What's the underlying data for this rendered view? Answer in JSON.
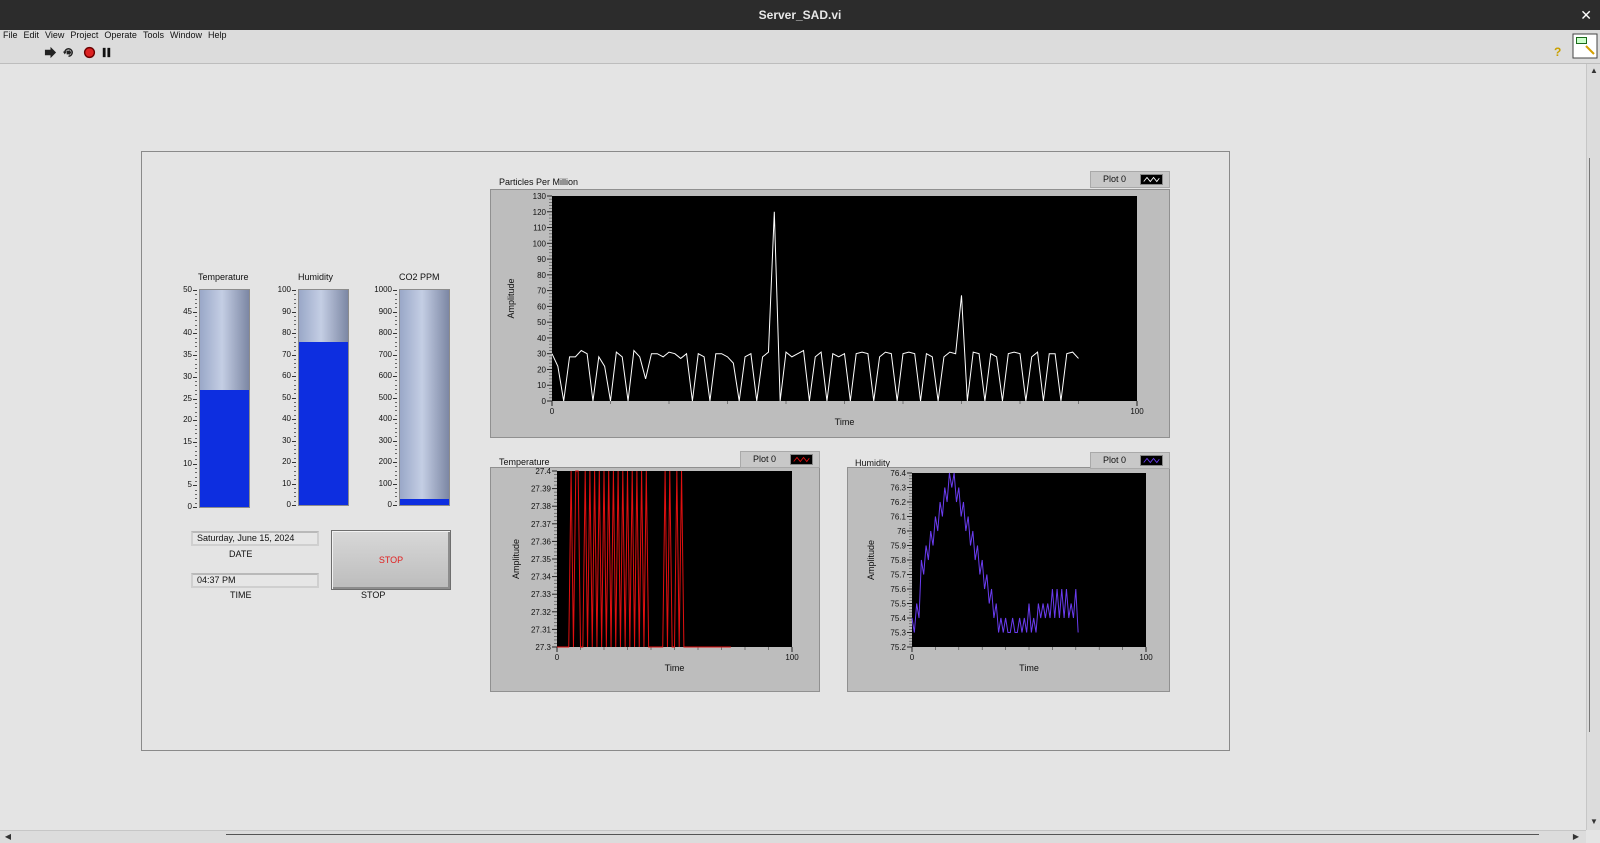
{
  "window": {
    "title": "Server_SAD.vi",
    "close_glyph": "✕"
  },
  "menu": [
    "File",
    "Edit",
    "View",
    "Project",
    "Operate",
    "Tools",
    "Window",
    "Help"
  ],
  "toolbar": {
    "icons": [
      "run-arrow-icon",
      "run-continuously-icon",
      "abort-icon",
      "pause-icon"
    ],
    "help_glyph": "?"
  },
  "tanks": [
    {
      "label": "Temperature",
      "scale": [
        "50",
        "45",
        "40",
        "35",
        "30",
        "25",
        "20",
        "15",
        "10",
        "5",
        "0"
      ],
      "max": 50,
      "value": 27,
      "fill_color": "#0d2ee0"
    },
    {
      "label": "Humidity",
      "scale": [
        "100",
        "90",
        "80",
        "70",
        "60",
        "50",
        "40",
        "30",
        "20",
        "10",
        "0"
      ],
      "max": 100,
      "value": 76,
      "fill_color": "#0d2ee0"
    },
    {
      "label": "CO2 PPM",
      "scale": [
        "1000",
        "900",
        "800",
        "700",
        "600",
        "500",
        "400",
        "300",
        "200",
        "100",
        "0"
      ],
      "max": 1000,
      "value": 30,
      "fill_color": "#0d2ee0"
    }
  ],
  "date": {
    "value": "Saturday, June 15, 2024",
    "label": "DATE"
  },
  "time": {
    "value": "04:37 PM",
    "label": "TIME"
  },
  "stop": {
    "button_text": "STOP",
    "label": "STOP"
  },
  "chart_data": [
    {
      "type": "line",
      "title": "Particles Per Million",
      "xlabel": "Time",
      "ylabel": "Amplitude",
      "xlim": [
        0,
        100
      ],
      "ylim": [
        0,
        130
      ],
      "xticks": [
        "0",
        "100"
      ],
      "yticks": [
        "130",
        "120",
        "110",
        "100",
        "90",
        "80",
        "70",
        "60",
        "50",
        "40",
        "30",
        "20",
        "10",
        "0"
      ],
      "legend": {
        "position": "top-right",
        "entry": "Plot 0"
      },
      "series": [
        {
          "color": "#ffffff",
          "values": [
            30,
            22,
            0,
            28,
            28,
            32,
            30,
            0,
            28,
            22,
            0,
            31,
            28,
            0,
            32,
            28,
            14,
            30,
            30,
            28,
            31,
            30,
            27,
            30,
            0,
            30,
            28,
            0,
            30,
            30,
            28,
            24,
            0,
            28,
            30,
            0,
            28,
            31,
            120,
            0,
            31,
            28,
            30,
            32,
            0,
            28,
            31,
            0,
            30,
            28,
            30,
            0,
            30,
            31,
            30,
            0,
            28,
            31,
            30,
            0,
            30,
            31,
            30,
            0,
            30,
            28,
            0,
            28,
            31,
            30,
            67,
            0,
            31,
            30,
            0,
            30,
            28,
            0,
            30,
            31,
            30,
            0,
            28,
            31,
            0,
            30,
            30,
            0,
            30,
            31,
            27
          ]
        }
      ]
    },
    {
      "type": "line",
      "title": "Temperature",
      "xlabel": "Time",
      "ylabel": "Amplitude",
      "xlim": [
        0,
        100
      ],
      "ylim": [
        27.3,
        27.4
      ],
      "xticks": [
        "0",
        "100"
      ],
      "yticks": [
        "27.4",
        "27.39",
        "27.38",
        "27.37",
        "27.36",
        "27.35",
        "27.34",
        "27.33",
        "27.32",
        "27.31",
        "27.3"
      ],
      "legend": {
        "position": "top-right",
        "entry": "Plot 0"
      },
      "series": [
        {
          "color": "#e01010",
          "values": [
            27.3,
            27.3,
            27.3,
            27.3,
            27.3,
            27.3,
            27.4,
            27.3,
            27.4,
            27.4,
            27.3,
            27.3,
            27.4,
            27.3,
            27.4,
            27.3,
            27.4,
            27.3,
            27.4,
            27.3,
            27.4,
            27.3,
            27.4,
            27.3,
            27.4,
            27.3,
            27.4,
            27.3,
            27.4,
            27.3,
            27.4,
            27.3,
            27.4,
            27.3,
            27.4,
            27.3,
            27.4,
            27.3,
            27.4,
            27.3,
            27.3,
            27.3,
            27.3,
            27.3,
            27.3,
            27.3,
            27.4,
            27.3,
            27.4,
            27.3,
            27.3,
            27.4,
            27.3,
            27.4,
            27.3,
            27.3,
            27.3,
            27.3,
            27.3,
            27.3,
            27.3,
            27.3,
            27.3,
            27.3,
            27.3,
            27.3,
            27.3,
            27.3,
            27.3,
            27.3,
            27.3,
            27.3,
            27.3,
            27.3,
            27.3
          ]
        }
      ]
    },
    {
      "type": "line",
      "title": "Humidity",
      "xlabel": "Time",
      "ylabel": "Amplitude",
      "xlim": [
        0,
        100
      ],
      "ylim": [
        75.2,
        76.4
      ],
      "xticks": [
        "0",
        "100"
      ],
      "yticks": [
        "76.4",
        "76.3",
        "76.2",
        "76.1",
        "76",
        "75.9",
        "75.8",
        "75.7",
        "75.6",
        "75.5",
        "75.4",
        "75.3",
        "75.2"
      ],
      "legend": {
        "position": "top-right",
        "entry": "Plot 0"
      },
      "series": [
        {
          "color": "#6a3cf0",
          "values": [
            75.4,
            75.3,
            75.5,
            75.4,
            75.8,
            75.7,
            75.9,
            75.8,
            76.0,
            75.9,
            76.1,
            76.0,
            76.2,
            76.1,
            76.3,
            76.2,
            76.4,
            76.3,
            76.4,
            76.2,
            76.3,
            76.1,
            76.2,
            76.0,
            76.1,
            75.9,
            76.0,
            75.8,
            75.9,
            75.7,
            75.8,
            75.6,
            75.7,
            75.5,
            75.6,
            75.4,
            75.5,
            75.3,
            75.4,
            75.3,
            75.4,
            75.3,
            75.3,
            75.4,
            75.3,
            75.3,
            75.4,
            75.3,
            75.4,
            75.3,
            75.5,
            75.3,
            75.4,
            75.3,
            75.5,
            75.4,
            75.5,
            75.4,
            75.5,
            75.4,
            75.6,
            75.4,
            75.6,
            75.4,
            75.6,
            75.4,
            75.6,
            75.4,
            75.5,
            75.4,
            75.6,
            75.3
          ]
        }
      ]
    }
  ]
}
